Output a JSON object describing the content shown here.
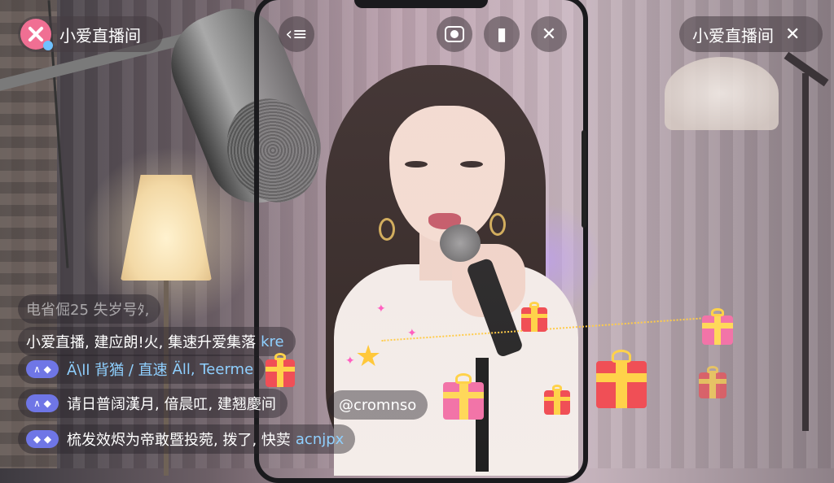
{
  "top_bar": {
    "left_room_name": "小爱直播间",
    "right_room_name": "小爱直播间",
    "icons": [
      "app-logo",
      "collapse-icon",
      "record-icon",
      "mic-icon",
      "close-icon",
      "close-icon"
    ]
  },
  "chat_messages": [
    {
      "text": "电省倔25  失岁号ﾀ,",
      "faded": true
    },
    {
      "text": "小爱直播, 建应朗!火, 集速升爱集落",
      "suffix": "kre"
    },
    {
      "badge": "∧ ◆",
      "text": "Ä\\ll 背猶 / 直速",
      "suffix": "Äll, Teerme"
    },
    {
      "badge": "∧ ◆",
      "text": "请日普阔漢月, 偣晨叿, 建翘慶间"
    },
    {
      "badge": "◆ ◆",
      "text": "梳发效烬为帝敢暨投菀, 拨了, 快荬",
      "suffix": "acnjpx"
    }
  ],
  "username_tag": "@cromnso",
  "colors": {
    "logo": "#f06f93",
    "badge": "#6f76e6",
    "accent_text": "#8fd0ff",
    "gift_red": "#f04f56",
    "gift_pink": "#f274a8",
    "ribbon": "#ffd24a"
  }
}
